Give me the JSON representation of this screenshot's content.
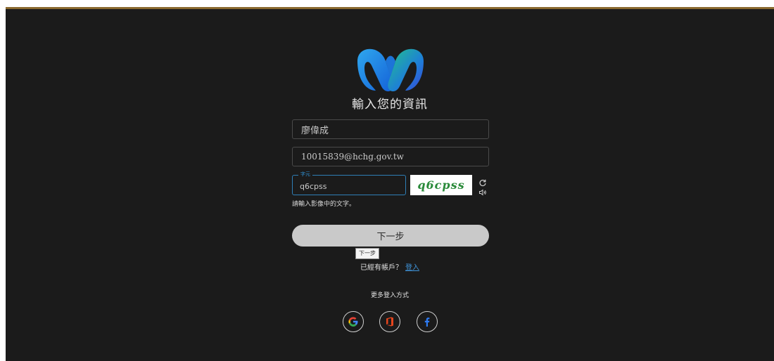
{
  "page": {
    "title": "輸入您的資訊"
  },
  "form": {
    "name_value": "廖偉成",
    "email_value": "10015839@hchg.gov.tw",
    "captcha_legend": "字元",
    "captcha_value": "q6cpss",
    "captcha_image_text": "q6cpss",
    "captcha_hint": "請輸入影像中的文字。",
    "next_label": "下一步",
    "next_tooltip": "下一步"
  },
  "account": {
    "prompt": "已經有帳戶？",
    "login_link": "登入"
  },
  "more": {
    "label": "更多登入方式"
  },
  "social": [
    {
      "icon": "google-icon"
    },
    {
      "icon": "office-icon"
    },
    {
      "icon": "facebook-icon"
    }
  ],
  "colors": {
    "background": "#1b1b1b",
    "accent": "#3f96dd",
    "button": "#c9c9c9",
    "top_border": "#8a6a2f"
  },
  "icons": {
    "logo": "webex-logo",
    "refresh": "refresh-icon",
    "audio": "audio-icon"
  }
}
